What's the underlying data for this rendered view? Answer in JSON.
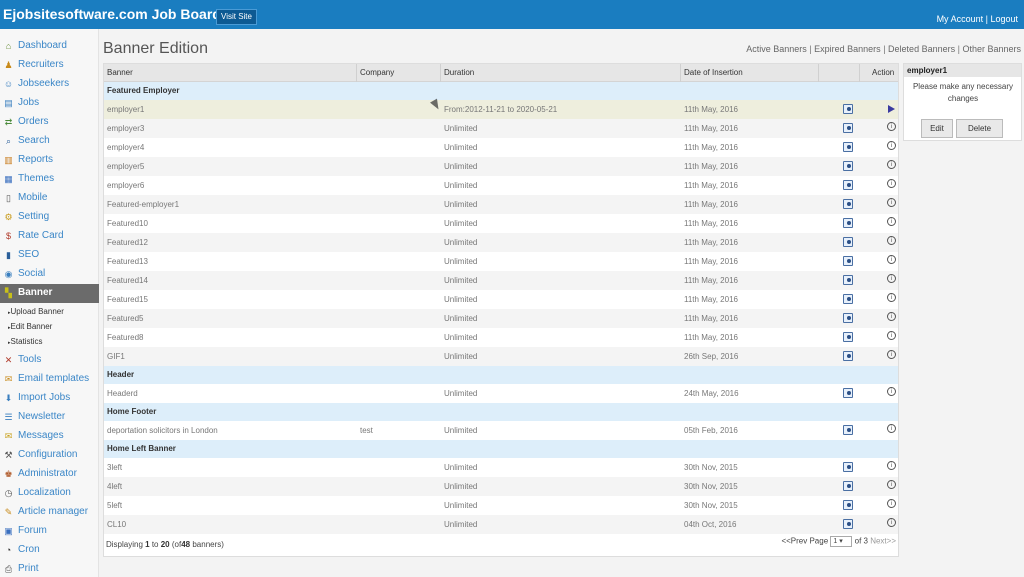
{
  "header": {
    "app_title": "Ejobsitesoftware.com Job Board",
    "visit_site": "Visit Site",
    "my_account": "My Account",
    "separator": "|",
    "logout": "Logout"
  },
  "sidebar": {
    "items": [
      {
        "label": "Dashboard",
        "icon": "home-icon"
      },
      {
        "label": "Recruiters",
        "icon": "recruiter-icon"
      },
      {
        "label": "Jobseekers",
        "icon": "jobseekers-icon"
      },
      {
        "label": "Jobs",
        "icon": "jobs-icon"
      },
      {
        "label": "Orders",
        "icon": "orders-icon"
      },
      {
        "label": "Search",
        "icon": "search-icon"
      },
      {
        "label": "Reports",
        "icon": "reports-icon"
      },
      {
        "label": "Themes",
        "icon": "themes-icon"
      },
      {
        "label": "Mobile",
        "icon": "mobile-icon"
      },
      {
        "label": "Setting",
        "icon": "setting-icon"
      },
      {
        "label": "Rate Card",
        "icon": "rate-card-icon"
      },
      {
        "label": "SEO",
        "icon": "seo-icon"
      },
      {
        "label": "Social",
        "icon": "social-icon"
      },
      {
        "label": "Banner",
        "icon": "banner-icon"
      },
      {
        "label": "Tools",
        "icon": "tools-icon"
      },
      {
        "label": "Email templates",
        "icon": "email-icon"
      },
      {
        "label": "Import Jobs",
        "icon": "import-icon"
      },
      {
        "label": "Newsletter",
        "icon": "newsletter-icon"
      },
      {
        "label": "Messages",
        "icon": "messages-icon"
      },
      {
        "label": "Configuration",
        "icon": "configuration-icon"
      },
      {
        "label": "Administrator",
        "icon": "administrator-icon"
      },
      {
        "label": "Localization",
        "icon": "localization-icon"
      },
      {
        "label": "Article manager",
        "icon": "article-icon"
      },
      {
        "label": "Forum",
        "icon": "forum-icon"
      },
      {
        "label": "Cron",
        "icon": "cron-icon"
      },
      {
        "label": "Print",
        "icon": "print-icon"
      }
    ],
    "banner_sub": [
      "Upload Banner",
      "Edit Banner",
      "Statistics"
    ]
  },
  "main": {
    "title": "Banner Edition",
    "view_links": [
      "Active Banners",
      "Expired Banners",
      "Deleted Banners",
      "Other Banners"
    ],
    "link_sep": "|",
    "columns": [
      "Banner",
      "Company",
      "Duration",
      "Date of Insertion",
      "Action"
    ],
    "groups": [
      "Featured Employer",
      "Header",
      "Home Footer",
      "Home Left Banner"
    ],
    "rows": [
      {
        "banner": "employer1",
        "company": "",
        "duration": "From:2012-11-21 to 2020-05-21",
        "date": "11th May, 2016"
      },
      {
        "banner": "employer3",
        "company": "",
        "duration": "Unlimited",
        "date": "11th May, 2016"
      },
      {
        "banner": "employer4",
        "company": "",
        "duration": "Unlimited",
        "date": "11th May, 2016"
      },
      {
        "banner": "employer5",
        "company": "",
        "duration": "Unlimited",
        "date": "11th May, 2016"
      },
      {
        "banner": "employer6",
        "company": "",
        "duration": "Unlimited",
        "date": "11th May, 2016"
      },
      {
        "banner": "Featured-employer1",
        "company": "",
        "duration": "Unlimited",
        "date": "11th May, 2016"
      },
      {
        "banner": "Featured10",
        "company": "",
        "duration": "Unlimited",
        "date": "11th May, 2016"
      },
      {
        "banner": "Featured12",
        "company": "",
        "duration": "Unlimited",
        "date": "11th May, 2016"
      },
      {
        "banner": "Featured13",
        "company": "",
        "duration": "Unlimited",
        "date": "11th May, 2016"
      },
      {
        "banner": "Featured14",
        "company": "",
        "duration": "Unlimited",
        "date": "11th May, 2016"
      },
      {
        "banner": "Featured15",
        "company": "",
        "duration": "Unlimited",
        "date": "11th May, 2016"
      },
      {
        "banner": "Featured5",
        "company": "",
        "duration": "Unlimited",
        "date": "11th May, 2016"
      },
      {
        "banner": "Featured8",
        "company": "",
        "duration": "Unlimited",
        "date": "11th May, 2016"
      },
      {
        "banner": "GIF1",
        "company": "",
        "duration": "Unlimited",
        "date": "26th Sep, 2016"
      },
      {
        "banner": "Headerd",
        "company": "",
        "duration": "Unlimited",
        "date": "24th May, 2016"
      },
      {
        "banner": "deportation solicitors in London",
        "company": "test",
        "duration": "Unlimited",
        "date": "05th Feb, 2016"
      },
      {
        "banner": "3left",
        "company": "",
        "duration": "Unlimited",
        "date": "30th Nov, 2015"
      },
      {
        "banner": "4left",
        "company": "",
        "duration": "Unlimited",
        "date": "30th Nov, 2015"
      },
      {
        "banner": "5left",
        "company": "",
        "duration": "Unlimited",
        "date": "30th Nov, 2015"
      },
      {
        "banner": "CL10",
        "company": "",
        "duration": "Unlimited",
        "date": "04th Oct, 2016"
      }
    ],
    "info_glyph": "i",
    "footer": {
      "displaying": "Displaying",
      "from": "1",
      "to_word": "to",
      "to": "20",
      "of_word": "(of",
      "total": "48",
      "suffix": "banners)"
    },
    "pager": {
      "prev": "<<Prev",
      "page_word": "Page",
      "page": "1",
      "of_text": "of 3",
      "next": "Next>>"
    }
  },
  "panel": {
    "title": "employer1",
    "message": "Please make any necessary changes",
    "edit": "Edit",
    "delete": "Delete"
  },
  "colors": {
    "topbar": "#1a7dc0",
    "link": "#3a86c7",
    "group_row": "#ddeefa"
  }
}
